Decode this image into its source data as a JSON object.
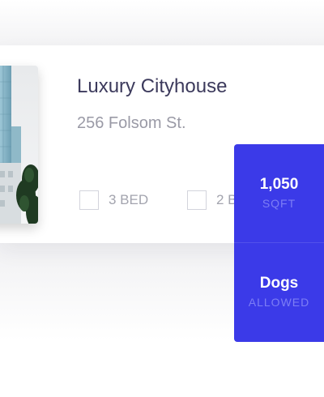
{
  "listing": {
    "title": "Luxury Cityhouse",
    "address": "256 Folsom St.",
    "image": "building-photo"
  },
  "features": [
    {
      "label": "3 BED",
      "icon": "bed-icon"
    },
    {
      "label": "2 B",
      "icon": "bath-icon"
    }
  ],
  "stats": [
    {
      "value": "1,050",
      "caption": "SQFT"
    },
    {
      "value": "Dogs",
      "caption": "ALLOWED"
    }
  ],
  "colors": {
    "accent": "#3b3ae8",
    "title": "#3c3a5c",
    "muted": "#9a9aa6"
  }
}
